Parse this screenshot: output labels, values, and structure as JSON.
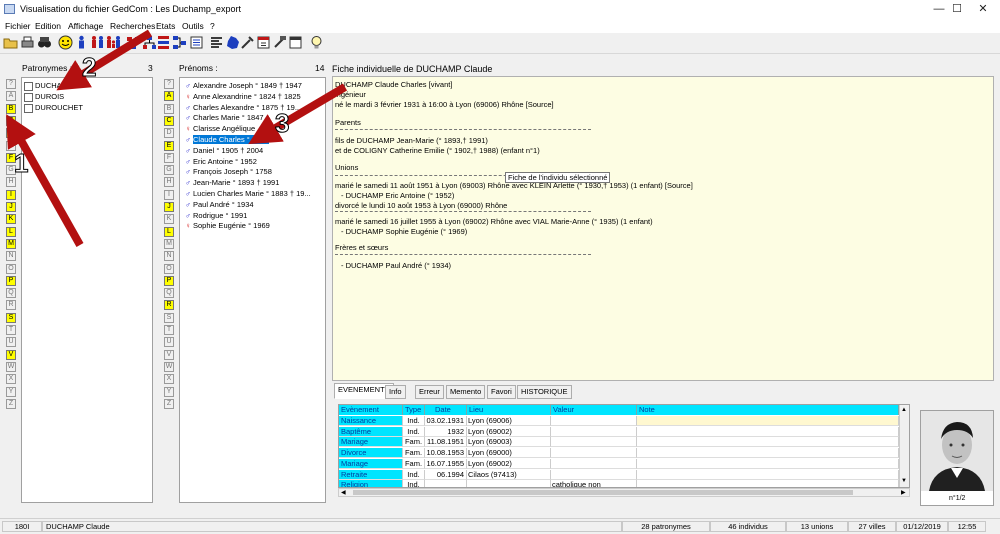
{
  "window": {
    "title": "Visualisation du fichier GedCom : Les Duchamp_export",
    "controls": {
      "minimize": "—",
      "maximize": "☐",
      "close": "✕"
    }
  },
  "menu": [
    "Fichier",
    "Edition",
    "Affichage",
    "Recherches",
    "Etats",
    "Outils",
    "?"
  ],
  "toolbar_icons": [
    "open-folder-icon",
    "print-icon",
    "binoculars-icon",
    "smiley-icon",
    "male-person-icon",
    "couple-icon",
    "family-icon",
    "tree-icon",
    "descendants-icon",
    "pedigree-icon",
    "chart-icon",
    "list-icon",
    "map-france-icon",
    "tools-icon",
    "calendar-icon",
    "hammer-icon",
    "window-icon",
    "bulb-icon"
  ],
  "surnames": {
    "header": "Patronymes :",
    "count": "3",
    "letters": [
      "?",
      "A",
      "B",
      "C",
      "D",
      "E",
      "F",
      "G",
      "H",
      "I",
      "J",
      "K",
      "L",
      "M",
      "N",
      "O",
      "P",
      "Q",
      "R",
      "S",
      "T",
      "U",
      "V",
      "W",
      "X",
      "Y",
      "Z"
    ],
    "active_letters": [
      "B",
      "C",
      "D",
      "F",
      "I",
      "J",
      "K",
      "L",
      "M",
      "P",
      "S",
      "V"
    ],
    "items": [
      "DUCHAMP",
      "DUROIS",
      "DUROUCHET"
    ]
  },
  "firstnames": {
    "header": "Prénoms :",
    "count": "14",
    "letters": [
      "?",
      "A",
      "B",
      "C",
      "D",
      "E",
      "F",
      "G",
      "H",
      "I",
      "J",
      "K",
      "L",
      "M",
      "N",
      "O",
      "P",
      "Q",
      "R",
      "S",
      "T",
      "U",
      "V",
      "W",
      "X",
      "Y",
      "Z"
    ],
    "active_letters": [
      "A",
      "C",
      "E",
      "J",
      "L",
      "P",
      "R"
    ],
    "items": [
      {
        "sex": "♂",
        "gender": "male",
        "name": "Alexandre Joseph",
        "dates": "° 1849 † 1947"
      },
      {
        "sex": "♀",
        "gender": "female",
        "name": "Anne Alexandrine",
        "dates": "° 1824 † 1825"
      },
      {
        "sex": "♂",
        "gender": "male",
        "name": "Charles Alexandre",
        "dates": "° 1875 † 19.."
      },
      {
        "sex": "♂",
        "gender": "male",
        "name": "Charles Marie",
        "dates": "° 1847"
      },
      {
        "sex": "♀",
        "gender": "female",
        "name": "Clarisse Angélique",
        "dates": ""
      },
      {
        "sex": "♂",
        "gender": "male",
        "name": "Claude Charles",
        "dates": "° 1931",
        "selected": true
      },
      {
        "sex": "♂",
        "gender": "male",
        "name": "Daniel",
        "dates": "° 1905 † 2004"
      },
      {
        "sex": "♂",
        "gender": "male",
        "name": "Eric Antoine",
        "dates": "° 1952"
      },
      {
        "sex": "♂",
        "gender": "male",
        "name": "François Joseph",
        "dates": "° 1758"
      },
      {
        "sex": "♂",
        "gender": "male",
        "name": "Jean-Marie",
        "dates": "° 1893 † 1991"
      },
      {
        "sex": "♂",
        "gender": "male",
        "name": "Lucien Charles Marie",
        "dates": "° 1883 † 19..."
      },
      {
        "sex": "♂",
        "gender": "male",
        "name": "Paul André",
        "dates": "° 1934"
      },
      {
        "sex": "♂",
        "gender": "male",
        "name": "Rodrigue",
        "dates": "° 1991"
      },
      {
        "sex": "♀",
        "gender": "female",
        "name": "Sophie Eugénie",
        "dates": "° 1969"
      }
    ]
  },
  "fiche": {
    "header": "Fiche individuelle de DUCHAMP Claude",
    "name_line": "DUCHAMP Claude Charles [vivant]",
    "profession": "ingénieur",
    "birth": "né le mardi 3 février 1931 à 16:00 à Lyon (69006) Rhône [Source]",
    "parents_title": "Parents",
    "father": "fils de DUCHAMP Jean-Marie (° 1893,† 1991)",
    "mother": "et de COLIGNY Catherine Emilie (° 1902,† 1988) (enfant n°1)",
    "unions_title": "Unions",
    "union1": "marié le samedi 11 août 1951 à Lyon (69003) Rhône avec KLEIN Arlette (° 1930,† 1953) (1 enfant) [Source]",
    "union1_child": "- DUCHAMP Eric Antoine (° 1952)",
    "union1_divorce": "divorcé le lundi 10 août 1953 à Lyon (69000) Rhône",
    "union2": "marié le samedi 16 juillet 1955 à Lyon (69002) Rhône avec VIAL Marie-Anne (° 1935) (1 enfant)",
    "union2_child": "- DUCHAMP Sophie Eugénie (° 1969)",
    "siblings_title": "Frères et sœurs",
    "sibling1": "- DUCHAMP Paul André (° 1934)",
    "tooltip": "Fiche de l'individu sélectionné"
  },
  "tabs": [
    "EVENEMENTS",
    "Info",
    "Erreur",
    "Memento",
    "Favori",
    "HISTORIQUE"
  ],
  "events": {
    "columns": [
      "Evènement",
      "Type",
      "Date",
      "Lieu",
      "Valeur",
      "Note"
    ],
    "rows": [
      [
        "Naissance",
        "Ind.",
        "03.02.1931",
        "Lyon (69006)",
        "",
        ""
      ],
      [
        "Baptême",
        "Ind.",
        "1932",
        "Lyon (69002)",
        "",
        ""
      ],
      [
        "Mariage",
        "Fam.",
        "11.08.1951",
        "Lyon (69003)",
        "",
        ""
      ],
      [
        "Divorce",
        "Fam.",
        "10.08.1953",
        "Lyon (69000)",
        "",
        ""
      ],
      [
        "Mariage",
        "Fam.",
        "16.07.1955",
        "Lyon (69002)",
        "",
        ""
      ],
      [
        "Retraite",
        "Ind.",
        "06.1994",
        "Cilaos (97413)",
        "",
        ""
      ],
      [
        "Religion",
        "Ind.",
        "",
        "",
        "catholique non",
        ""
      ]
    ]
  },
  "photo": {
    "caption": "n°1/2"
  },
  "annotations": [
    "1",
    "2",
    "3"
  ],
  "status": {
    "id": "180I",
    "person": "DUCHAMP Claude",
    "patronymes": "28 patronymes",
    "individus": "46 individus",
    "unions": "13 unions",
    "villes": "27 villes",
    "date": "01/12/2019",
    "time": "12:55"
  }
}
